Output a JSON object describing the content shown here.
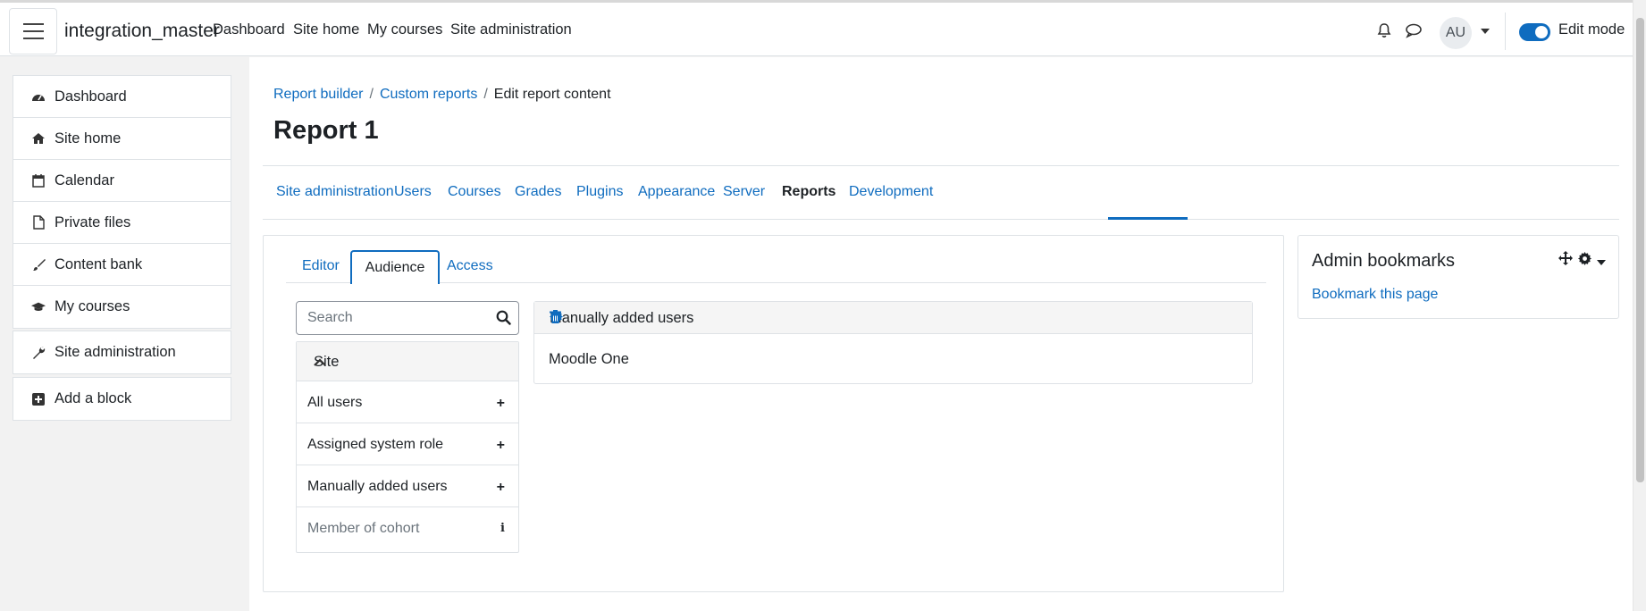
{
  "navbar": {
    "brand": "integration_master",
    "links": [
      "Dashboard",
      "Site home",
      "My courses",
      "Site administration"
    ],
    "avatar_initials": "AU",
    "edit_mode_label": "Edit mode",
    "edit_mode_on": true
  },
  "drawer": {
    "items": [
      {
        "label": "Dashboard",
        "icon": "dashboard-icon"
      },
      {
        "label": "Site home",
        "icon": "home-icon"
      },
      {
        "label": "Calendar",
        "icon": "calendar-icon"
      },
      {
        "label": "Private files",
        "icon": "file-icon"
      },
      {
        "label": "Content bank",
        "icon": "paint-brush-icon"
      },
      {
        "label": "My courses",
        "icon": "graduation-cap-icon"
      }
    ],
    "site_admin": "Site administration",
    "add_block": "Add a block"
  },
  "breadcrumb": [
    "Report builder",
    "Custom reports",
    "Edit report content"
  ],
  "page_title": "Report 1",
  "secondary_nav": {
    "items": [
      "Site administration",
      "Users",
      "Courses",
      "Grades",
      "Plugins",
      "Appearance",
      "Server",
      "Reports",
      "Development"
    ],
    "active": "Reports"
  },
  "tabs": {
    "items": [
      "Editor",
      "Audience",
      "Access"
    ],
    "active": "Audience"
  },
  "search": {
    "placeholder": "Search",
    "value": ""
  },
  "audience_sidebar": {
    "section": "Site",
    "items": [
      {
        "label": "All users",
        "action": "+"
      },
      {
        "label": "Assigned system role",
        "action": "+"
      },
      {
        "label": "Manually added users",
        "action": "+"
      },
      {
        "label": "Member of cohort",
        "action": "i",
        "disabled": true
      }
    ]
  },
  "audience_card": {
    "title": "Manually added users",
    "content": "Moodle One"
  },
  "admin_bookmarks": {
    "title": "Admin bookmarks",
    "link": "Bookmark this page"
  },
  "colors": {
    "accent": "#0f6cbf",
    "text": "#1d2125",
    "border": "#dee2e6"
  }
}
